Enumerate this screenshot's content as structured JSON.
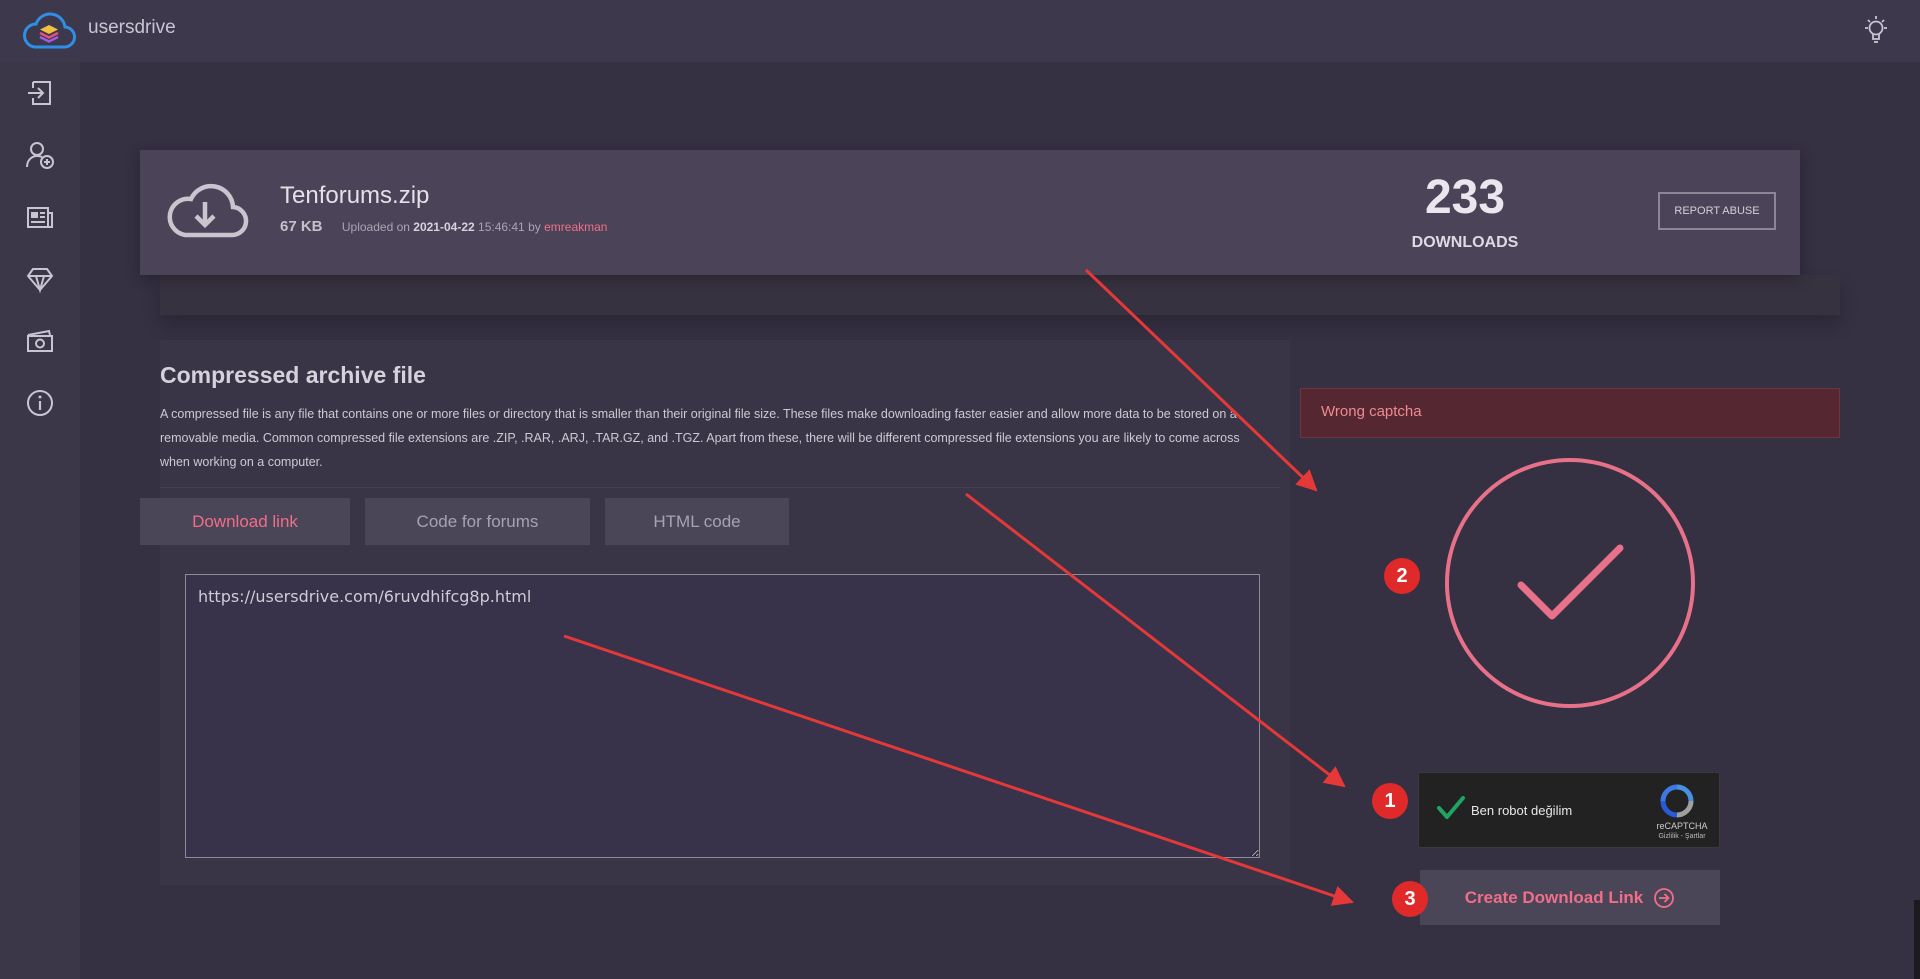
{
  "app": {
    "brand": "usersdrive"
  },
  "icons": {
    "logo": "cloud-layers-logo-icon",
    "theme": "lightbulb-icon",
    "nav": [
      "login-icon",
      "add-user-icon",
      "news-icon",
      "diamond-icon",
      "money-icon",
      "info-icon"
    ],
    "file": "cloud-download-icon",
    "create_arrow": "arrow-circle-right-icon"
  },
  "file": {
    "name": "Tenforums.zip",
    "size": "67 KB",
    "uploaded_prefix": "Uploaded on",
    "upload_date": "2021-04-22",
    "upload_time": "15:46:41",
    "by": "by",
    "uploader": "emreakman",
    "downloads": "233",
    "downloads_label": "DOWNLOADS",
    "report_label": "REPORT ABUSE"
  },
  "description": {
    "title": "Compressed archive file",
    "text": "A compressed file is any file that contains one or more files or directory that is smaller than their original file size. These files make downloading faster easier and allow more data to be stored on a removable media. Common compressed file extensions are .ZIP, .RAR, .ARJ, .TAR.GZ, and .TGZ. Apart from these, there will be different compressed file extensions you are likely to come across when working on a computer."
  },
  "tabs": [
    {
      "label": "Download link",
      "active": true
    },
    {
      "label": "Code for forums",
      "active": false
    },
    {
      "label": "HTML code",
      "active": false
    }
  ],
  "link_value": "https://usersdrive.com/6ruvdhifcg8p.html",
  "alert": {
    "text": "Wrong captcha"
  },
  "recaptcha": {
    "label": "Ben robot değilim",
    "brand": "reCAPTCHA",
    "terms": "Gizlilik - Şartlar"
  },
  "create_button": {
    "label": "Create Download Link"
  },
  "badges": [
    "1",
    "2",
    "3"
  ],
  "colors": {
    "accent": "#f06e88",
    "background": "#353042",
    "card": "#4b4458",
    "alert_bg": "#552731",
    "annotation_red": "#e02a2a",
    "check_green": "#1fa463"
  }
}
